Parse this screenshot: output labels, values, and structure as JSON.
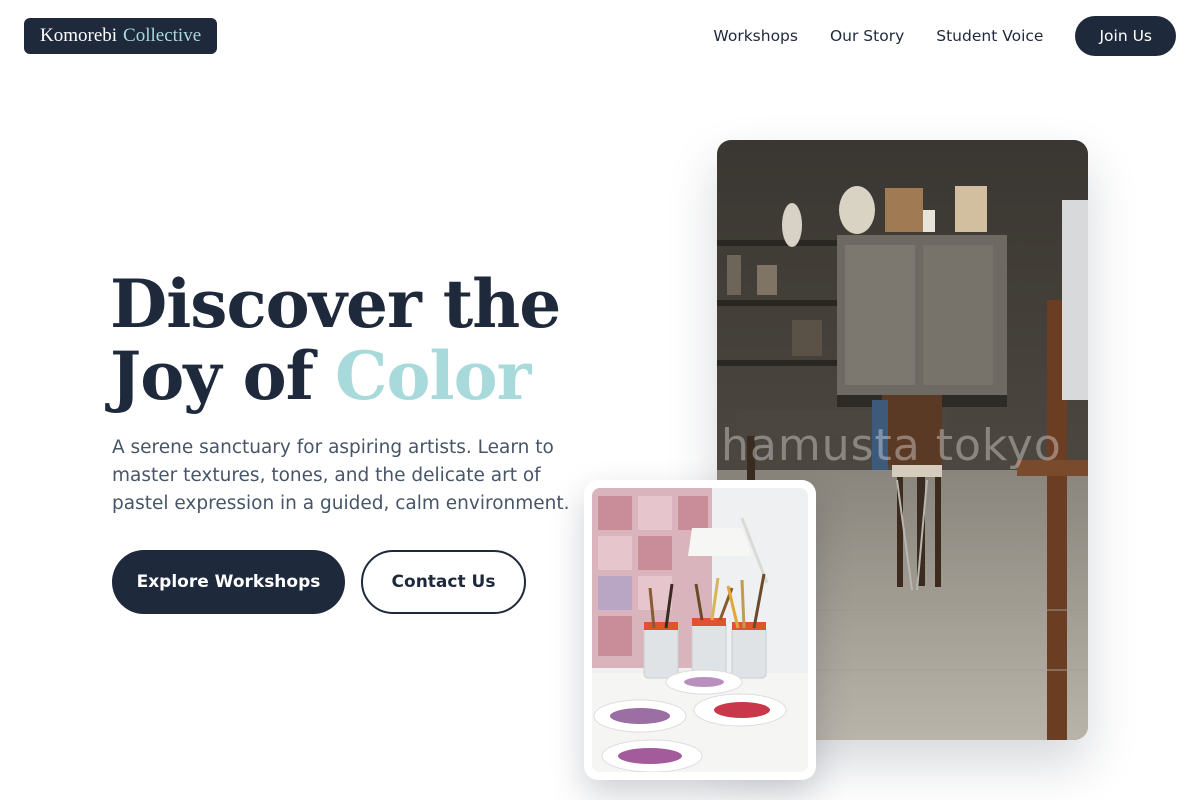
{
  "brand": {
    "name": "Komorebi",
    "accent": "Collective"
  },
  "nav": {
    "links": [
      "Workshops",
      "Our Story",
      "Student Voice"
    ],
    "cta": "Join Us"
  },
  "hero": {
    "headline_line1": "Discover the",
    "headline_line2_prefix": "Joy of",
    "headline_accent": "Color",
    "subtitle": "A serene sanctuary for aspiring artists. Learn to master textures, tones, and the delicate art of pastel expression in a guided, calm environment.",
    "primary_button": "Explore Workshops",
    "secondary_button": "Contact Us"
  },
  "images": {
    "main_photo_watermark": "hamusta tokyo"
  },
  "colors": {
    "navy": "#1e293b",
    "accent": "#a8dadc",
    "body_text": "#475569"
  }
}
